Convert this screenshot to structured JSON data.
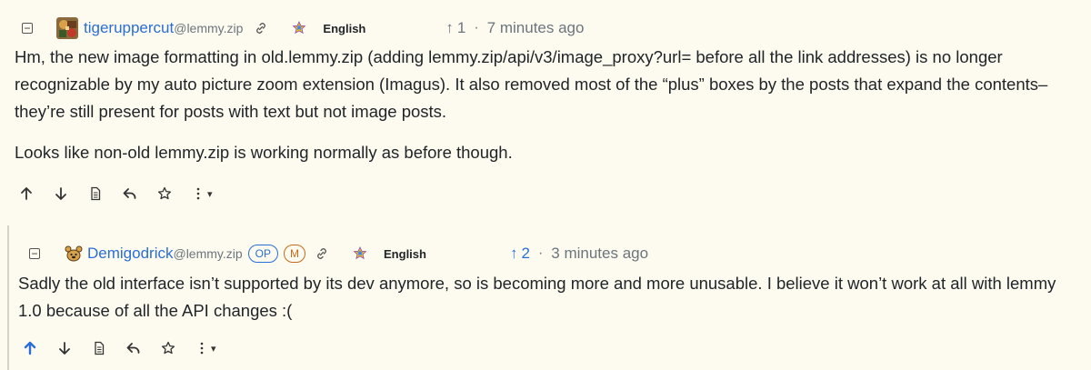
{
  "comments": [
    {
      "collapse_symbol": "−",
      "username": "tigeruppercut",
      "domain": "@lemmy.zip",
      "language": "English",
      "vote_arrow": "↑",
      "score": "1",
      "separator": "·",
      "time": "7 minutes ago",
      "paragraphs": [
        "Hm, the new image formatting in old.lemmy.zip (adding lemmy.zip/api/v3/image_proxy?url= before all the link addresses) is no longer recognizable by my auto picture zoom extension (Imagus). It also removed most of the “plus” boxes by the posts that expand the contents–they’re still present for posts with text but not image posts.",
        "Looks like non-old lemmy.zip is working normally as before though."
      ],
      "actions_more_caret": "▾"
    },
    {
      "collapse_symbol": "−",
      "username": "Demigodrick",
      "domain": "@lemmy.zip",
      "badges": [
        "OP",
        "M"
      ],
      "language": "English",
      "vote_arrow": "↑",
      "score": "2",
      "separator": "·",
      "time": "3 minutes ago",
      "paragraphs": [
        "Sadly the old interface isn’t supported by its dev anymore, so is becoming more and more unusable. I believe it won’t work at all with lemmy 1.0 because of all the API changes :("
      ],
      "actions_more_caret": "▾"
    }
  ],
  "colors": {
    "background": "#fdfbef",
    "link_blue": "#2a6ed6",
    "mod_orange": "#c46a1a",
    "muted": "#6c757d"
  }
}
